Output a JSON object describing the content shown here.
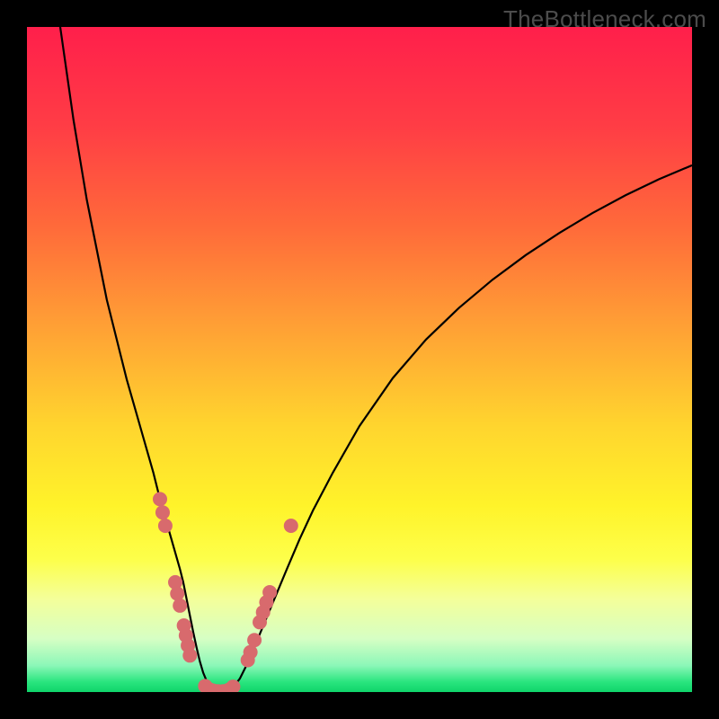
{
  "watermark": "TheBottleneck.com",
  "chart_data": {
    "type": "line",
    "title": "",
    "xlabel": "",
    "ylabel": "",
    "xlim": [
      0,
      100
    ],
    "ylim": [
      0,
      100
    ],
    "grid": false,
    "legend": false,
    "background_gradient": {
      "stops": [
        {
          "pos": 0.0,
          "color": "#ff1f4b"
        },
        {
          "pos": 0.15,
          "color": "#ff3d45"
        },
        {
          "pos": 0.3,
          "color": "#ff6a3a"
        },
        {
          "pos": 0.45,
          "color": "#ffa035"
        },
        {
          "pos": 0.6,
          "color": "#ffd52e"
        },
        {
          "pos": 0.72,
          "color": "#fff32a"
        },
        {
          "pos": 0.8,
          "color": "#fdff4a"
        },
        {
          "pos": 0.86,
          "color": "#f4ff9a"
        },
        {
          "pos": 0.92,
          "color": "#d6ffc4"
        },
        {
          "pos": 0.96,
          "color": "#8cf7b8"
        },
        {
          "pos": 0.985,
          "color": "#29e57e"
        },
        {
          "pos": 1.0,
          "color": "#0fd46a"
        }
      ]
    },
    "series": [
      {
        "name": "curve",
        "color": "#000000",
        "stroke_width": 2.2,
        "x": [
          5,
          6,
          7,
          8,
          9,
          10,
          11,
          12,
          13,
          14,
          15,
          16,
          17,
          18,
          19,
          20,
          21,
          22,
          23,
          23.5,
          24,
          24.5,
          25,
          25.5,
          26,
          26.5,
          27,
          27.5,
          28,
          29,
          30,
          31,
          32,
          33,
          34,
          35,
          37,
          39,
          41,
          43,
          46,
          50,
          55,
          60,
          65,
          70,
          75,
          80,
          85,
          90,
          95,
          100
        ],
        "y": [
          100,
          93,
          86,
          80,
          74,
          69,
          64,
          59,
          55,
          51,
          47,
          43.5,
          40,
          36.5,
          33,
          29,
          25.5,
          22,
          18.5,
          16.5,
          14,
          11.5,
          9,
          6.7,
          4.6,
          2.9,
          1.7,
          0.9,
          0.35,
          0.05,
          0.12,
          0.7,
          2.0,
          4.0,
          6.3,
          8.7,
          13.5,
          18.3,
          23,
          27.3,
          33,
          40,
          47.2,
          53,
          57.8,
          62,
          65.7,
          69,
          72,
          74.7,
          77.1,
          79.2
        ]
      }
    ],
    "scatter": {
      "name": "dots",
      "color": "#d86a6d",
      "radius": 8,
      "points": [
        {
          "x": 20.0,
          "y": 29.0
        },
        {
          "x": 20.4,
          "y": 27.0
        },
        {
          "x": 20.8,
          "y": 25.0
        },
        {
          "x": 22.3,
          "y": 16.5
        },
        {
          "x": 22.6,
          "y": 14.8
        },
        {
          "x": 23.0,
          "y": 13.0
        },
        {
          "x": 23.6,
          "y": 10.0
        },
        {
          "x": 23.9,
          "y": 8.5
        },
        {
          "x": 24.2,
          "y": 7.0
        },
        {
          "x": 24.5,
          "y": 5.5
        },
        {
          "x": 26.8,
          "y": 0.9
        },
        {
          "x": 27.4,
          "y": 0.4
        },
        {
          "x": 28.0,
          "y": 0.2
        },
        {
          "x": 28.7,
          "y": 0.1
        },
        {
          "x": 29.5,
          "y": 0.1
        },
        {
          "x": 30.3,
          "y": 0.3
        },
        {
          "x": 31.0,
          "y": 0.8
        },
        {
          "x": 33.2,
          "y": 4.8
        },
        {
          "x": 33.6,
          "y": 6.0
        },
        {
          "x": 34.2,
          "y": 7.8
        },
        {
          "x": 35.0,
          "y": 10.5
        },
        {
          "x": 35.5,
          "y": 12.0
        },
        {
          "x": 36.0,
          "y": 13.5
        },
        {
          "x": 36.5,
          "y": 15.0
        },
        {
          "x": 39.7,
          "y": 25.0
        }
      ]
    }
  }
}
